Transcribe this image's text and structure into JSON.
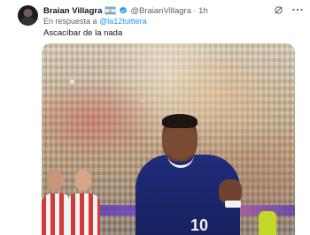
{
  "tweet": {
    "display_name": "Braian Villagra",
    "handle": "@BraianVillagra",
    "separator": "·",
    "time": "1h",
    "reply_prefix": "En respuesta a",
    "reply_mention": "@la12tuittera",
    "text": "Ascacíbar de la nada",
    "media": {
      "jersey_number": "10"
    }
  },
  "icons": [
    "grok-icon",
    "more-icon",
    "verified-icon",
    "argentina-flag-icon"
  ],
  "colors": {
    "link": "#1d9bf0",
    "secondary_text": "#536471",
    "verified": "#1d9bf0"
  }
}
